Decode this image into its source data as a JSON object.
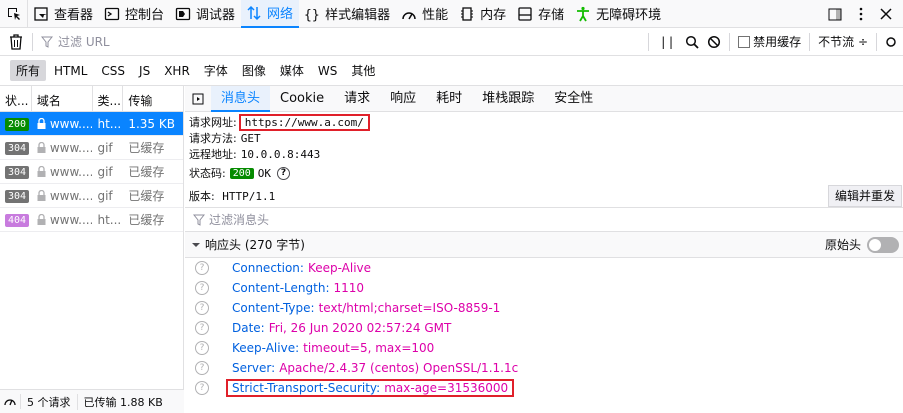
{
  "toolbar": {
    "tabs": [
      {
        "label": "查看器",
        "icon": "inspector-icon"
      },
      {
        "label": "控制台",
        "icon": "console-icon"
      },
      {
        "label": "调试器",
        "icon": "debugger-icon"
      },
      {
        "label": "网络",
        "icon": "network-icon",
        "active": true
      },
      {
        "label": "样式编辑器",
        "icon": "style-editor-icon"
      },
      {
        "label": "性能",
        "icon": "performance-icon"
      },
      {
        "label": "内存",
        "icon": "memory-icon"
      },
      {
        "label": "存储",
        "icon": "storage-icon"
      },
      {
        "label": "无障碍环境",
        "icon": "accessibility-icon"
      }
    ]
  },
  "filterbar": {
    "url_placeholder": "过滤 URL",
    "pause_label": "| |",
    "disable_cache_label": "禁用缓存",
    "throttle_label": "不节流 ÷"
  },
  "types": [
    "所有",
    "HTML",
    "CSS",
    "JS",
    "XHR",
    "字体",
    "图像",
    "媒体",
    "WS",
    "其他"
  ],
  "list": {
    "columns": [
      "状...",
      "域名",
      "类...",
      "传输"
    ],
    "rows": [
      {
        "status": "200",
        "domain": "www....",
        "type": "ht...",
        "transfer": "1.35 KB",
        "status_color": "#058b00"
      },
      {
        "status": "304",
        "domain": "www....",
        "type": "gif",
        "transfer": "已缓存",
        "status_color": "#737373"
      },
      {
        "status": "304",
        "domain": "www....",
        "type": "gif",
        "transfer": "已缓存",
        "status_color": "#737373"
      },
      {
        "status": "304",
        "domain": "www....",
        "type": "gif",
        "transfer": "已缓存",
        "status_color": "#737373"
      },
      {
        "status": "404",
        "domain": "www....",
        "type": "ht...",
        "transfer": "已缓存",
        "status_color": "#c87bde"
      }
    ],
    "footer": {
      "requests": "5 个请求",
      "transferred": "已传输 1.88 KB"
    }
  },
  "details": {
    "tabs": [
      "消息头",
      "Cookie",
      "请求",
      "响应",
      "耗时",
      "堆栈跟踪",
      "安全性"
    ],
    "summary": {
      "url_label": "请求网址:",
      "url_value": "https://www.a.com/",
      "method_label": "请求方法:",
      "method_value": "GET",
      "remote_label": "远程地址:",
      "remote_value": "10.0.0.8:443",
      "status_label": "状态码:",
      "status_code": "200",
      "status_text": "OK",
      "version_label": "版本:",
      "version_value": "HTTP/1.1"
    },
    "edit_resend": "编辑并重发",
    "header_filter_placeholder": "过滤消息头",
    "response_section": "响应头 (270 字节)",
    "raw_headers_label": "原始头",
    "headers": [
      {
        "name": "Connection:",
        "value": "Keep-Alive"
      },
      {
        "name": "Content-Length:",
        "value": "1110"
      },
      {
        "name": "Content-Type:",
        "value": "text/html;charset=ISO-8859-1"
      },
      {
        "name": "Date:",
        "value": "Fri, 26 Jun 2020 02:57:24 GMT"
      },
      {
        "name": "Keep-Alive:",
        "value": "timeout=5, max=100"
      },
      {
        "name": "Server:",
        "value": "Apache/2.4.37 (centos) OpenSSL/1.1.1c"
      },
      {
        "name": "Strict-Transport-Security:",
        "value": "max-age=31536000",
        "highlight": true
      }
    ]
  }
}
